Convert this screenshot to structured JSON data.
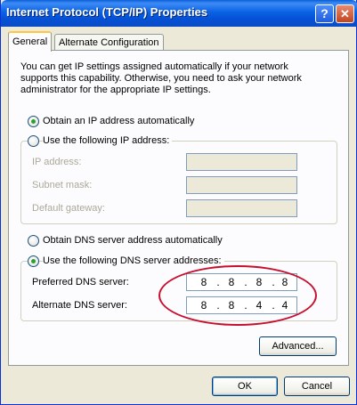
{
  "window": {
    "title": "Internet Protocol (TCP/IP) Properties",
    "help": "?",
    "close": "✕"
  },
  "tabs": {
    "general": "General",
    "alternate": "Alternate Configuration"
  },
  "description": "You can get IP settings assigned automatically if your network supports this capability. Otherwise, you need to ask your network administrator for the appropriate IP settings.",
  "ip": {
    "auto_label": "Obtain an IP address automatically",
    "manual_label": "Use the following IP address:",
    "address_label": "IP address:",
    "subnet_label": "Subnet mask:",
    "gateway_label": "Default gateway:"
  },
  "dns": {
    "auto_label": "Obtain DNS server address automatically",
    "manual_label": "Use the following DNS server addresses:",
    "preferred_label": "Preferred DNS server:",
    "alternate_label": "Alternate DNS server:",
    "preferred": [
      "8",
      "8",
      "8",
      "8"
    ],
    "alternate": [
      "8",
      "8",
      "4",
      "4"
    ]
  },
  "buttons": {
    "advanced": "Advanced...",
    "ok": "OK",
    "cancel": "Cancel"
  },
  "colors": {
    "title_bar": "#0a62e4",
    "annotation": "#c8102e",
    "dialog_bg": "#ece9d8"
  }
}
